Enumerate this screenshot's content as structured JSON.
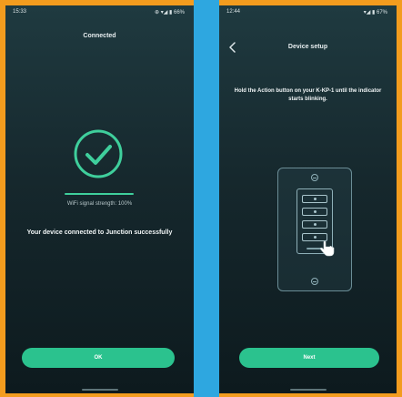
{
  "colors": {
    "outer_background": "#f39c1e",
    "divider_strip": "#2ea7e0",
    "accent": "#2bc28e",
    "screen_background": "#16282d"
  },
  "left_screen": {
    "statusbar": {
      "time": "15:33",
      "indicators": "⊕ ▾◢ ▮ 66%"
    },
    "title": "Connected",
    "status_icon": "check-circle-icon",
    "signal_text": "WiFi signal strength: 100%",
    "message": "Your device connected to Junction successfully",
    "ok_button": "OK"
  },
  "right_screen": {
    "statusbar": {
      "time": "12:44",
      "indicators": "▾◢ ▮ 67%"
    },
    "back_icon": "chevron-left-icon",
    "title": "Device setup",
    "instructions": "Hold the Action button on your K-KP-1 until the indicator starts blinking.",
    "illustration_icon": "wall-keypad-icon",
    "pointer_icon": "pointing-hand-icon",
    "next_button": "Next"
  }
}
